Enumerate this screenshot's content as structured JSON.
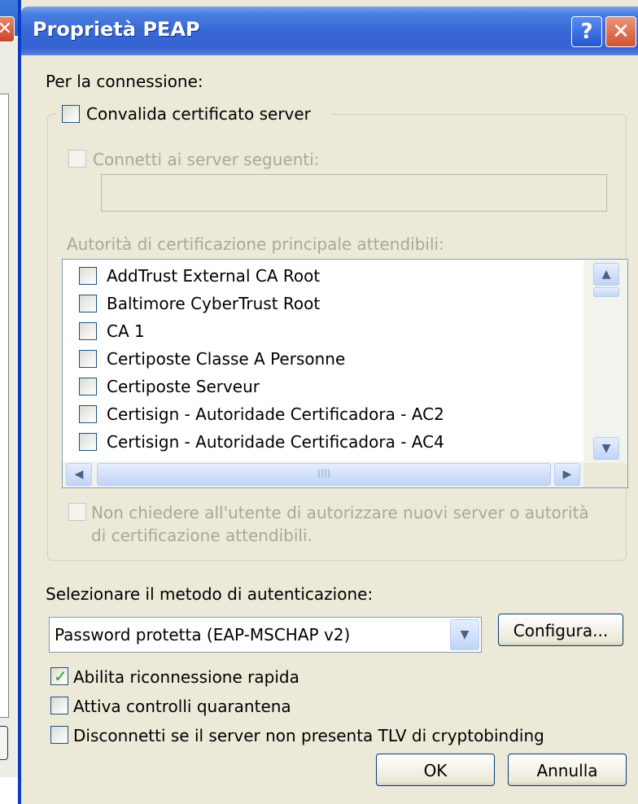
{
  "dialog": {
    "title": "Proprietà PEAP",
    "help_glyph": "?",
    "close_glyph": "✕"
  },
  "connection_label": "Per la connessione:",
  "validate_cert": {
    "label": "Convalida certificato server",
    "checked": false
  },
  "connect_servers": {
    "label": "Connetti ai server seguenti:",
    "checked": false,
    "enabled": false,
    "value": ""
  },
  "trusted_ca_label": "Autorità di certificazione principale attendibili:",
  "ca_list": [
    {
      "label": "AddTrust External CA Root",
      "checked": false
    },
    {
      "label": "Baltimore CyberTrust Root",
      "checked": false
    },
    {
      "label": "CA 1",
      "checked": false
    },
    {
      "label": "Certiposte Classe A Personne",
      "checked": false
    },
    {
      "label": "Certiposte Serveur",
      "checked": false
    },
    {
      "label": "Certisign - Autoridade Certificadora - AC2",
      "checked": false
    },
    {
      "label": "Certisign - Autoridade Certificadora - AC4",
      "checked": false
    }
  ],
  "scroll": {
    "up": "▲",
    "down": "▼",
    "left": "◀",
    "right": "▶",
    "grip": "IIII"
  },
  "no_prompt": {
    "line1": "Non chiedere all'utente di autorizzare nuovi server o autorità",
    "line2": "di certificazione attendibili.",
    "enabled": false
  },
  "auth_method_label": "Selezionare il metodo di autenticazione:",
  "auth_method": {
    "selected": "Password protetta (EAP-MSCHAP v2)",
    "arrow": "▼"
  },
  "configure_button": "Configura...",
  "options": [
    {
      "label": "Abilita riconnessione rapida",
      "checked": true
    },
    {
      "label": "Attiva controlli quarantena",
      "checked": false
    },
    {
      "label": "Disconnetti se il server non presenta TLV di cryptobinding",
      "checked": false
    }
  ],
  "ok_button": "OK",
  "cancel_button": "Annulla",
  "colors": {
    "title_bar": "#3868d6",
    "dialog_bg": "#ece9d8",
    "checkmark": "#21a121"
  }
}
